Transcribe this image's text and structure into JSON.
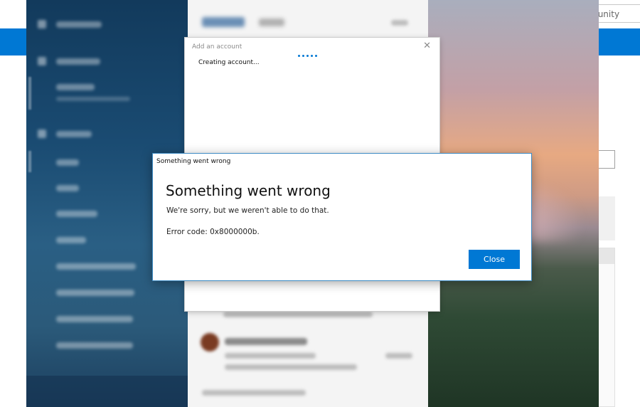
{
  "background_page": {
    "search_text": "munity",
    "accent_color": "#0078d4"
  },
  "add_account_dialog": {
    "title": "Add an account",
    "status": "Creating account...",
    "close_icon": "close-icon"
  },
  "error_dialog": {
    "window_title": "Something went wrong",
    "heading": "Something went wrong",
    "message": "We're sorry, but we weren't able to do that.",
    "error_code": "Error code: 0x8000000b.",
    "close_label": "Close",
    "button_color": "#0078d4"
  }
}
